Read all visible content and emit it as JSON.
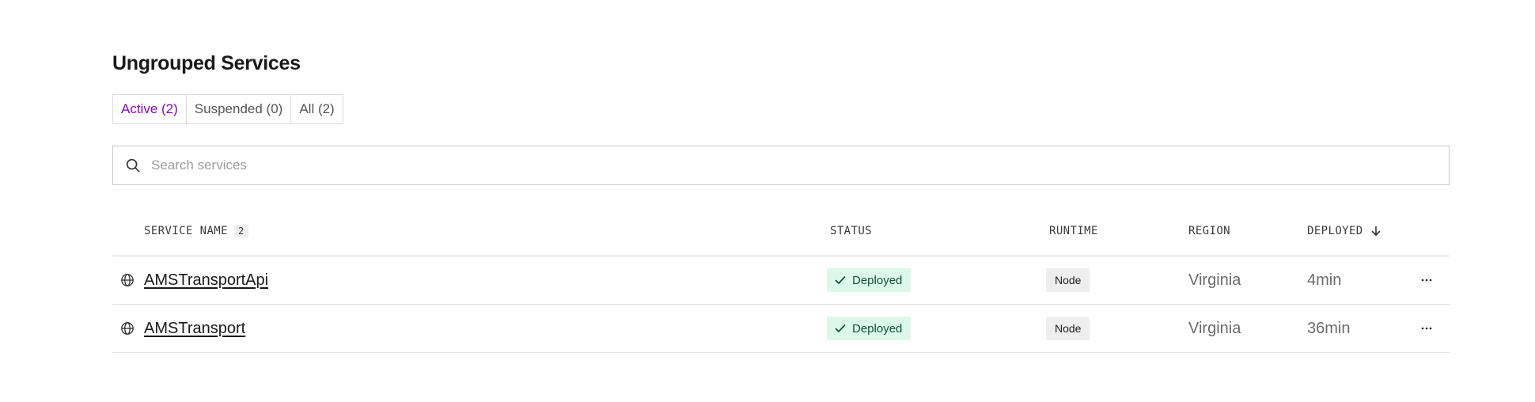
{
  "section": {
    "title": "Ungrouped Services"
  },
  "tabs": [
    {
      "label": "Active (2)",
      "active": true
    },
    {
      "label": "Suspended (0)",
      "active": false
    },
    {
      "label": "All (2)",
      "active": false
    }
  ],
  "search": {
    "placeholder": "Search services",
    "value": "",
    "icon": "search-icon"
  },
  "table": {
    "columns": {
      "service_name": "SERVICE NAME",
      "service_count": "2",
      "status": "STATUS",
      "runtime": "RUNTIME",
      "region": "REGION",
      "deployed": "DEPLOYED"
    },
    "sort": {
      "column": "deployed",
      "direction": "descending",
      "icon": "arrow-down-icon"
    },
    "rows": [
      {
        "icon": "globe-icon",
        "name": "AMSTransportApi",
        "status": "Deployed",
        "runtime": "Node",
        "region": "Virginia",
        "deployed": "4min"
      },
      {
        "icon": "globe-icon",
        "name": "AMSTransport",
        "status": "Deployed",
        "runtime": "Node",
        "region": "Virginia",
        "deployed": "36min"
      }
    ]
  },
  "colors": {
    "accent": "#8a05be",
    "status_bg": "#dcf8e8",
    "status_text": "#11503a",
    "runtime_bg": "#eeeeee"
  }
}
